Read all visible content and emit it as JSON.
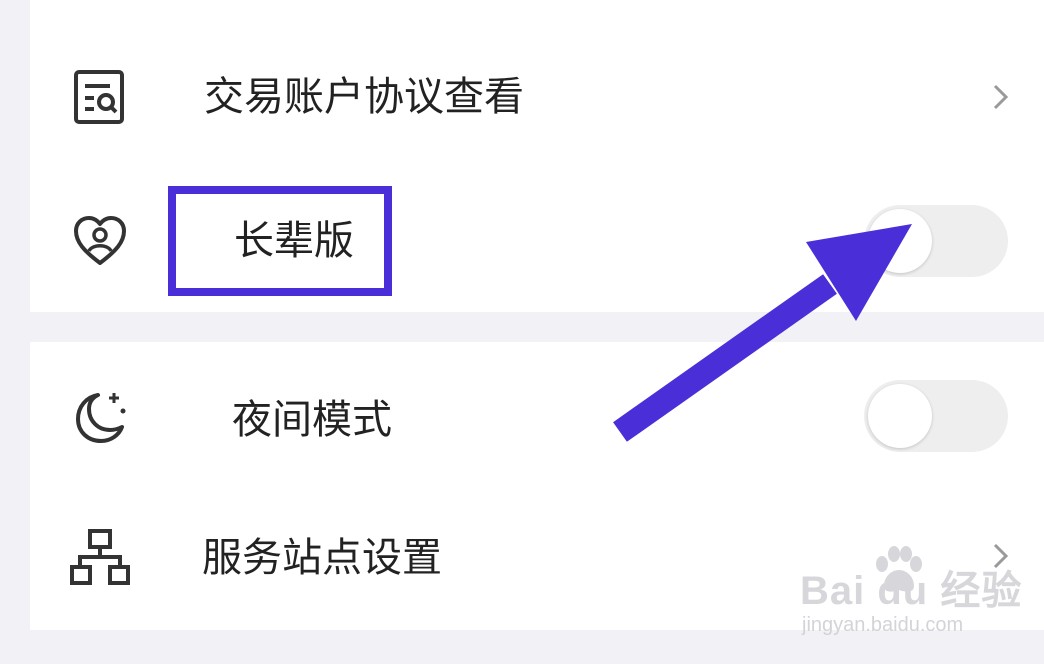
{
  "settings": {
    "items": [
      {
        "label": "交易账户协议查看",
        "icon": "document-search-icon",
        "control": "chevron"
      },
      {
        "label": "长辈版",
        "icon": "heart-user-icon",
        "control": "toggle",
        "enabled": false
      },
      {
        "label": "夜间模式",
        "icon": "moon-stars-icon",
        "control": "toggle",
        "enabled": false
      },
      {
        "label": "服务站点设置",
        "icon": "network-tree-icon",
        "control": "chevron"
      }
    ]
  },
  "annotation": {
    "color": "#4a2fd8",
    "highlighted_item": "长辈版"
  },
  "watermark": {
    "brand": "Bai du 经验",
    "url": "jingyan.baidu.com"
  }
}
